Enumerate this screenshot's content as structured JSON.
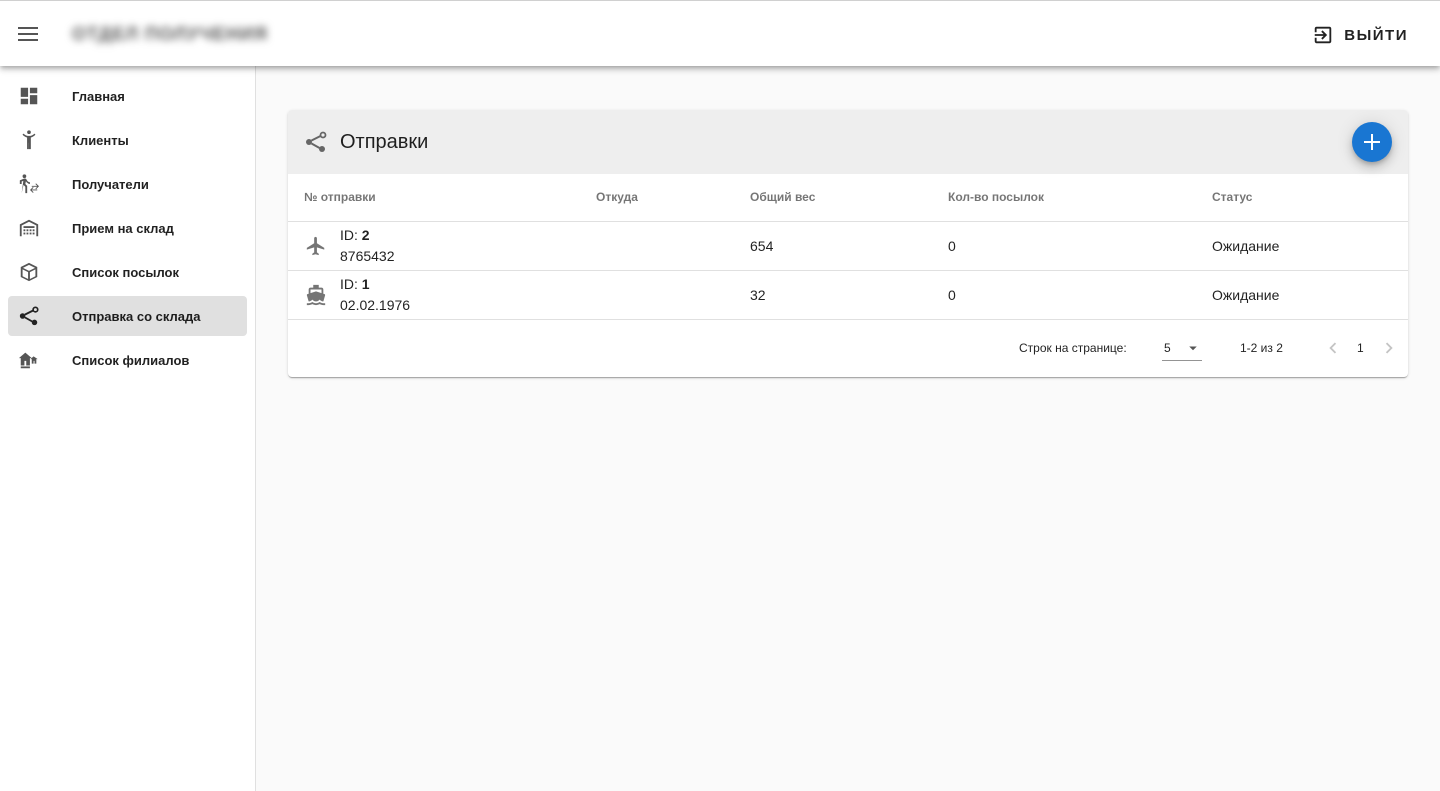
{
  "header": {
    "brand": "ОТДЕЛ ПОЛУЧЕНИЯ",
    "logout_label": "ВЫЙТИ"
  },
  "sidebar": {
    "items": [
      {
        "label": "Главная",
        "icon": "dashboard-icon"
      },
      {
        "label": "Клиенты",
        "icon": "person-icon"
      },
      {
        "label": "Получатели",
        "icon": "transfer-person-icon"
      },
      {
        "label": "Прием на склад",
        "icon": "warehouse-icon"
      },
      {
        "label": "Список посылок",
        "icon": "package-icon"
      },
      {
        "label": "Отправка со склада",
        "icon": "share-route-icon",
        "active": true
      },
      {
        "label": "Список филиалов",
        "icon": "branches-icon"
      }
    ]
  },
  "card": {
    "title": "Отправки",
    "columns": [
      "№ отправки",
      "Откуда",
      "Общий вес",
      "Кол-во посылок",
      "Статус"
    ],
    "rows": [
      {
        "icon": "airplane-icon",
        "id_prefix": "ID: ",
        "id": "2",
        "sub": "8765432",
        "from": "",
        "weight": "654",
        "count": "0",
        "status": "Ожидание"
      },
      {
        "icon": "ship-icon",
        "id_prefix": "ID: ",
        "id": "1",
        "sub": "02.02.1976",
        "from": "",
        "weight": "32",
        "count": "0",
        "status": "Ожидание"
      }
    ],
    "pagination": {
      "rows_per_page_label": "Строк на странице:",
      "rows_per_page": "5",
      "range": "1-2 из 2",
      "page": "1"
    }
  },
  "colors": {
    "accent": "#1976d2",
    "active_nav_bg": "#e0e0e0",
    "header_bg": "#eeeeee"
  }
}
